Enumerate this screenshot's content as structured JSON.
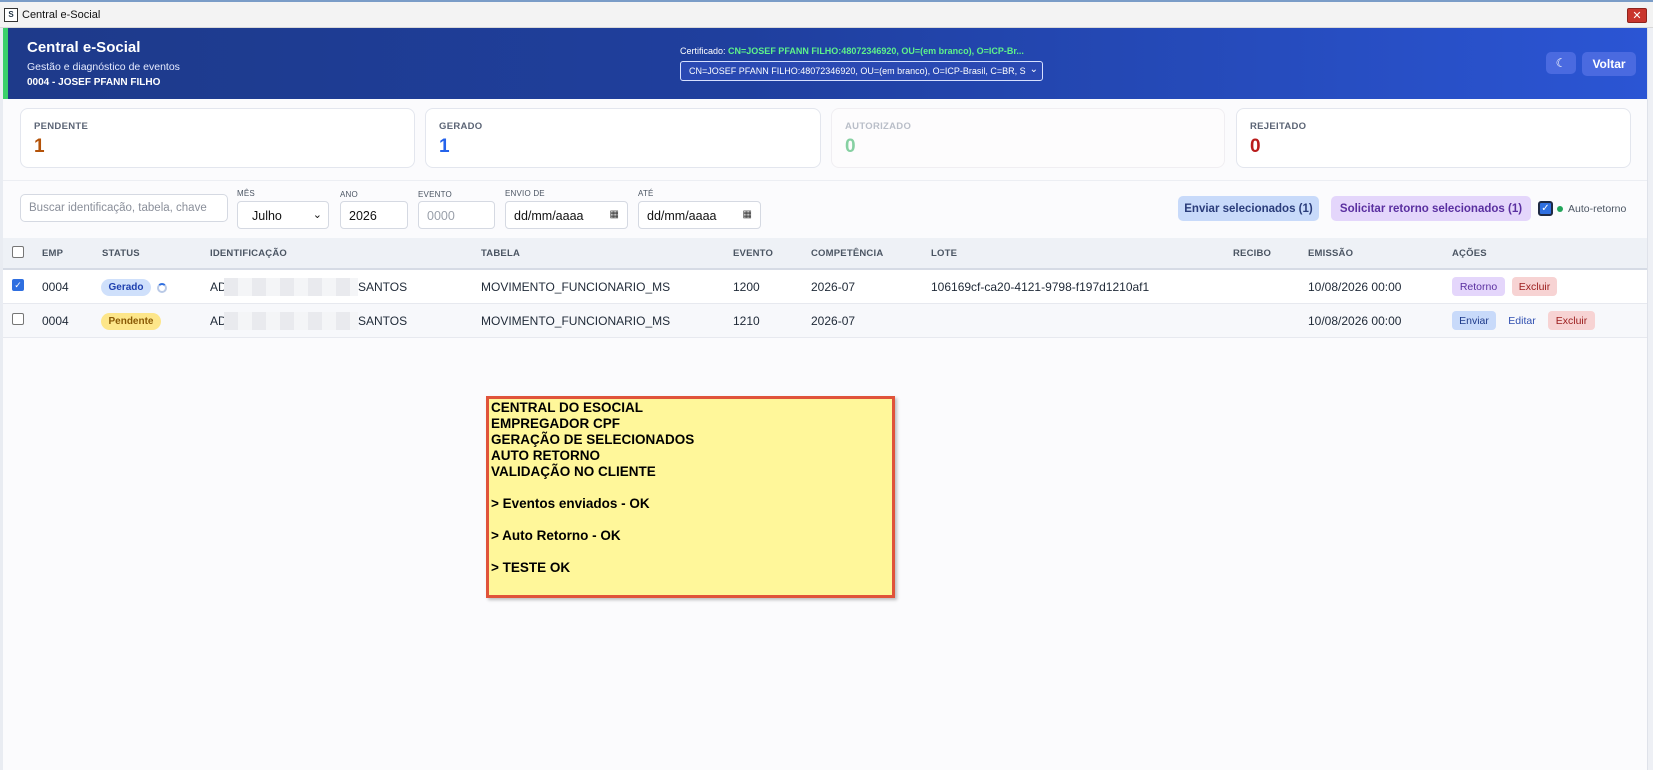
{
  "window": {
    "title": "Central e-Social",
    "icon": "app-logo-icon",
    "close_icon": "close-icon"
  },
  "header": {
    "title": "Central e-Social",
    "subtitle": "Gestão e diagnóstico de eventos",
    "company": "0004 - JOSEF PFANN FILHO",
    "cert_label": "Certificado:",
    "cert_value": "CN=JOSEF PFANN FILHO:48072346920, OU=(em branco), O=ICP-Br...",
    "cert_select": "CN=JOSEF PFANN FILHO:48072346920, OU=(em branco), O=ICP-Brasil, C=BR, S",
    "theme_icon": "☾",
    "back_label": "Voltar"
  },
  "stats": [
    {
      "label": "PENDENTE",
      "value": "1",
      "color": "#b45309"
    },
    {
      "label": "GERADO",
      "value": "1",
      "color": "#2563eb"
    },
    {
      "label": "AUTORIZADO",
      "value": "0",
      "color": "#86d0a2"
    },
    {
      "label": "REJEITADO",
      "value": "0",
      "color": "#b91c1c"
    }
  ],
  "filters": {
    "search_placeholder": "Buscar identificação, tabela, chave",
    "month_label": "MÊS",
    "month_value": "Julho",
    "year_label": "ANO",
    "year_value": "2026",
    "event_label": "EVENTO",
    "event_placeholder": "0000",
    "from_label": "ENVIO DE",
    "from_placeholder": "dd/mm/aaaa",
    "to_label": "ATÉ",
    "to_placeholder": "dd/mm/aaaa",
    "send_selected": "Enviar selecionados (1)",
    "request_selected": "Solicitar retorno selecionados (1)",
    "auto_return": "Auto-retorno"
  },
  "table": {
    "columns": [
      "EMP",
      "STATUS",
      "IDENTIFICAÇÃO",
      "TABELA",
      "EVENTO",
      "COMPETÊNCIA",
      "LOTE",
      "RECIBO",
      "EMISSÃO",
      "AÇÕES"
    ],
    "rows": [
      {
        "checked": true,
        "emp": "0004",
        "status": "Gerado",
        "id_start": "AD",
        "id_end": "SANTOS",
        "tabela": "MOVIMENTO_FUNCIONARIO_MS",
        "evento": "1200",
        "competencia": "2026-07",
        "lote": "106169cf-ca20-4121-9798-f197d1210af1",
        "recibo": "",
        "emissao": "10/08/2026 00:00",
        "actions": [
          "Retorno",
          "Excluir"
        ]
      },
      {
        "checked": false,
        "emp": "0004",
        "status": "Pendente",
        "id_start": "AD",
        "id_end": "SANTOS",
        "tabela": "MOVIMENTO_FUNCIONARIO_MS",
        "evento": "1210",
        "competencia": "2026-07",
        "lote": "",
        "recibo": "",
        "emissao": "10/08/2026 00:00",
        "actions": [
          "Enviar",
          "Editar",
          "Excluir"
        ]
      }
    ]
  },
  "note": {
    "lines": [
      "CENTRAL DO ESOCIAL",
      "EMPREGADOR CPF",
      "GERAÇÃO DE SELECIONADOS",
      "AUTO RETORNO",
      "VALIDAÇÃO NO CLIENTE",
      "",
      "> Eventos enviados - OK",
      "",
      "> Auto Retorno - OK",
      "",
      "> TESTE OK"
    ]
  }
}
